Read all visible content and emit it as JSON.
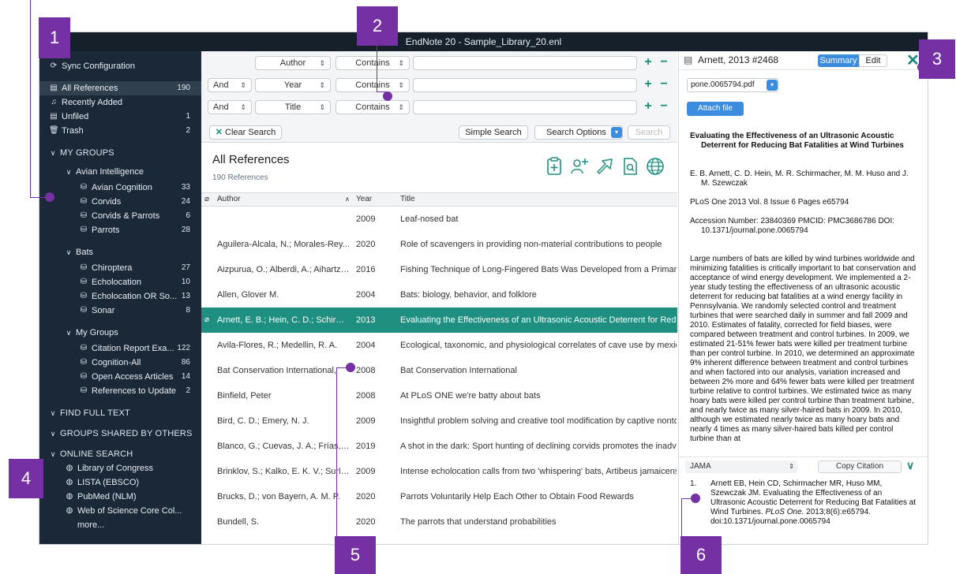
{
  "window": {
    "title": "EndNote 20 - Sample_Library_20.enl"
  },
  "sidebar": {
    "sync": "Sync Configuration",
    "library": [
      {
        "label": "All References",
        "count": "190",
        "icon": "all-references-icon"
      },
      {
        "label": "Recently Added",
        "count": "",
        "icon": "recently-added-icon"
      },
      {
        "label": "Unfiled",
        "count": "1",
        "icon": "unfiled-icon"
      },
      {
        "label": "Trash",
        "count": "2",
        "icon": "trash-icon"
      }
    ],
    "my_groups_header": "MY GROUPS",
    "group_sets": [
      {
        "label": "Avian Intelligence",
        "items": [
          {
            "label": "Avian Cognition",
            "count": "33"
          },
          {
            "label": "Corvids",
            "count": "24"
          },
          {
            "label": "Corvids & Parrots",
            "count": "6"
          },
          {
            "label": "Parrots",
            "count": "28"
          }
        ]
      },
      {
        "label": "Bats",
        "items": [
          {
            "label": "Chiroptera",
            "count": "27"
          },
          {
            "label": "Echolocation",
            "count": "10"
          },
          {
            "label": "Echolocation OR So...",
            "count": "13"
          },
          {
            "label": "Sonar",
            "count": "8"
          }
        ]
      },
      {
        "label": "My Groups",
        "items": [
          {
            "label": "Citation Report Exa...",
            "count": "122"
          },
          {
            "label": "Cognition-All",
            "count": "86"
          },
          {
            "label": "Open Access Articles",
            "count": "14"
          },
          {
            "label": "References to Update",
            "count": "2"
          }
        ]
      }
    ],
    "find_full_text": "FIND FULL TEXT",
    "groups_shared": "GROUPS SHARED BY OTHERS",
    "online_search": "ONLINE SEARCH",
    "online_items": [
      "Library of Congress",
      "LISTA (EBSCO)",
      "PubMed (NLM)",
      "Web of Science Core Col...",
      "more..."
    ]
  },
  "search": {
    "rows": [
      {
        "bool": "",
        "field": "Author",
        "op": "Contains"
      },
      {
        "bool": "And",
        "field": "Year",
        "op": "Contains"
      },
      {
        "bool": "And",
        "field": "Title",
        "op": "Contains"
      }
    ],
    "clear": "Clear Search",
    "simple": "Simple Search",
    "options": "Search Options",
    "search": "Search"
  },
  "list": {
    "title": "All References",
    "count": "190 References",
    "columns": {
      "author": "Author",
      "year": "Year",
      "title": "Title"
    },
    "rows": [
      {
        "author": "",
        "year": "2009",
        "title": "Leaf-nosed bat"
      },
      {
        "author": "Aguilera-Alcala, N.; Morales-Rey...",
        "year": "2020",
        "title": "Role of scavengers in providing non-material contributions to people"
      },
      {
        "author": "Aizpurua, O.; Alberdi, A.; Aihartza...",
        "year": "2016",
        "title": "Fishing Technique of Long-Fingered Bats Was Developed from a Primary R"
      },
      {
        "author": "Allen, Glover M.",
        "year": "2004",
        "title": "Bats: biology, behavior, and folklore"
      },
      {
        "author": "Arnett, E. B.; Hein, C. D.; Schirma...",
        "year": "2013",
        "title": "Evaluating the Effectiveness of an Ultrasonic Acoustic Deterrent for Reduc"
      },
      {
        "author": "Avila-Flores, R.; Medellin, R. A.",
        "year": "2004",
        "title": "Ecological, taxonomic, and physiological correlates of cave use by mexica"
      },
      {
        "author": "Bat Conservation International,",
        "year": "2008",
        "title": "Bat Conservation International"
      },
      {
        "author": "Binfield, Peter",
        "year": "2008",
        "title": "At PLoS ONE we're batty about bats"
      },
      {
        "author": "Bird, C. D.; Emery, N. J.",
        "year": "2009",
        "title": "Insightful problem solving and creative tool modification by captive nontoo"
      },
      {
        "author": "Blanco, G.; Cuevas, J. A.; Frías, O...",
        "year": "2019",
        "title": "A shot in the dark: Sport hunting of declining corvids promotes the inadve"
      },
      {
        "author": "Brinklov, S.; Kalko, E. K. V.; Surlyk...",
        "year": "2009",
        "title": "Intense echolocation calls from two 'whispering' bats, Artibeus jamaicensi"
      },
      {
        "author": "Brucks, D.; von Bayern, A. M. P.",
        "year": "2020",
        "title": "Parrots Voluntarily Help Each Other to Obtain Food Rewards"
      },
      {
        "author": "Bundell, S.",
        "year": "2020",
        "title": "The parrots that understand probabilities"
      }
    ]
  },
  "panel": {
    "title": "Arnett, 2013 #2468",
    "summary": "Summary",
    "edit": "Edit",
    "pdf": "pone.0065794.pdf",
    "attach": "Attach file",
    "ref_title": "Evaluating the Effectiveness of an Ultrasonic Acoustic Deterrent for Reducing Bat Fatalities at Wind Turbines",
    "authors": "E. B. Arnett, C. D. Hein, M. R. Schirmacher, M. M. Huso and J. M. Szewczak",
    "journal": "PLoS One 2013 Vol. 8 Issue 6 Pages e65794",
    "accession": "Accession Number: 23840369 PMCID: PMC3686786 DOI: 10.1371/journal.pone.0065794",
    "abstract": "Large numbers of bats are killed by wind turbines worldwide and minimizing fatalities is critically important to bat conservation and acceptance of wind energy development. We implemented a 2-year study testing the effectiveness of an ultrasonic acoustic deterrent for reducing bat fatalities at a wind energy facility in Pennsylvania. We randomly selected control and treatment turbines that were searched daily in summer and fall 2009 and 2010. Estimates of fatality, corrected for field biases, were compared between treatment and control turbines. In 2009, we estimated 21-51% fewer bats were killed per treatment turbine than per control turbine. In 2010, we determined an approximate 9% inherent difference between treatment and control turbines and when factored into our analysis, variation increased and between 2% more and 64% fewer bats were killed per treatment turbine relative to control turbines. We estimated twice as many hoary bats were killed per control turbine than treatment turbine, and nearly twice as many silver-haired bats in 2009. In 2010, although we estimated nearly twice as many hoary bats and nearly 4 times as many silver-haired bats killed per control turbine than at",
    "style": "JAMA",
    "copy": "Copy Citation",
    "cite_num": "1.",
    "cite_pre": "Arnett EB, Hein CD, Schirmacher MR, Huso MM, Szewczak JM. Evaluating the Effectiveness of an Ultrasonic Acoustic Deterrent for Reducing Bat Fatalities at Wind Turbines. ",
    "cite_journal": "PLoS One.",
    "cite_post": " 2013;8(6):e65794. doi:10.1371/journal.pone.0065794"
  },
  "callouts": [
    "1",
    "2",
    "3",
    "4",
    "5",
    "6"
  ],
  "colors": {
    "accent": "#1e8f80",
    "callout": "#7531a3",
    "sidebar": "#1b2837",
    "blue": "#3c8de0"
  }
}
